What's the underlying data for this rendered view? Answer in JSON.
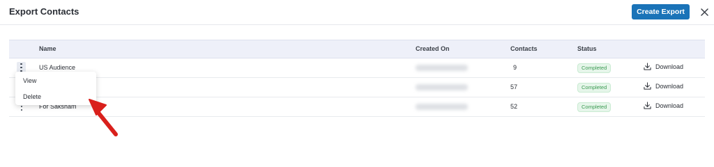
{
  "header": {
    "title": "Export Contacts",
    "create_button": "Create Export",
    "close_icon": "close-icon"
  },
  "table": {
    "columns": [
      "Name",
      "Created On",
      "Contacts",
      "Status"
    ],
    "rows": [
      {
        "name": "US Audience",
        "created_on": "",
        "contacts": "9",
        "status": "Completed",
        "action": "Download"
      },
      {
        "name": "",
        "created_on": "",
        "contacts": "57",
        "status": "Completed",
        "action": "Download"
      },
      {
        "name": "For Saksham",
        "created_on": "",
        "contacts": "52",
        "status": "Completed",
        "action": "Download"
      }
    ]
  },
  "context_menu": {
    "items": [
      "View",
      "Delete"
    ]
  },
  "colors": {
    "primary": "#1a73b8",
    "status_green": "#3b9a52",
    "arrow_red": "#d9201c"
  }
}
